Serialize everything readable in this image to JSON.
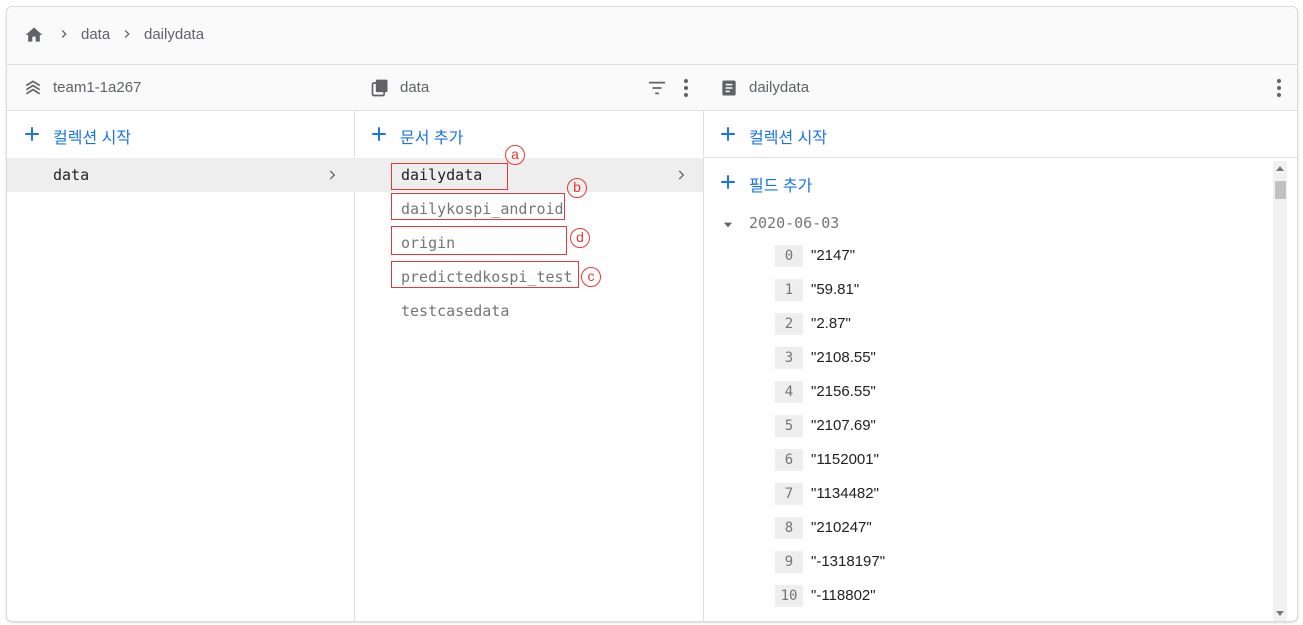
{
  "breadcrumb": {
    "items": [
      "data",
      "dailydata"
    ]
  },
  "columns": {
    "root": {
      "title": "team1-1a267",
      "add_label": "컬렉션 시작",
      "items": [
        "data"
      ]
    },
    "collection": {
      "title": "data",
      "add_label": "문서 추가",
      "items": [
        "dailydata",
        "dailykospi_android",
        "origin",
        "predictedkospi_test",
        "testcasedata"
      ]
    },
    "document": {
      "title": "dailydata",
      "add_collection_label": "컬렉션 시작",
      "add_field_label": "필드 추가",
      "field": {
        "key": "2020-06-03",
        "entries": [
          {
            "index": "0",
            "value": "\"2147\""
          },
          {
            "index": "1",
            "value": "\"59.81\""
          },
          {
            "index": "2",
            "value": "\"2.87\""
          },
          {
            "index": "3",
            "value": "\"2108.55\""
          },
          {
            "index": "4",
            "value": "\"2156.55\""
          },
          {
            "index": "5",
            "value": "\"2107.69\""
          },
          {
            "index": "6",
            "value": "\"1152001\""
          },
          {
            "index": "7",
            "value": "\"1134482\""
          },
          {
            "index": "8",
            "value": "\"210247\""
          },
          {
            "index": "9",
            "value": "\"-1318197\""
          },
          {
            "index": "10",
            "value": "\"-118802\""
          }
        ]
      }
    }
  },
  "annotations": [
    "a",
    "b",
    "d",
    "c"
  ],
  "colors": {
    "accent": "#1a73e8",
    "annotation": "#e53935",
    "selected_bg": "#eeeeee"
  },
  "icons": [
    "home-icon",
    "chevron-right-icon",
    "database-icon",
    "collection-icon",
    "document-icon",
    "filter-icon",
    "more-vert-icon",
    "plus-icon",
    "arrow-drop-down-icon"
  ]
}
